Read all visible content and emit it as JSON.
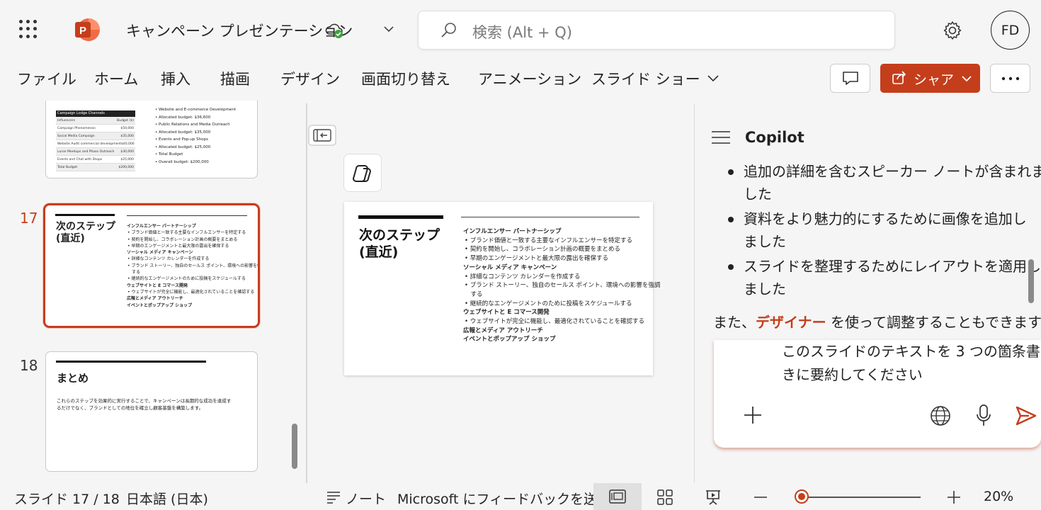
{
  "titlebar": {
    "doc_title": "キャンペーン プレゼンテーション",
    "search_placeholder": "検索 (Alt + Q)",
    "avatar_initials": "FD"
  },
  "ribbon": {
    "tabs": [
      "ファイル",
      "ホーム",
      "挿入",
      "描画",
      "デザイン",
      "画面切り替え",
      "アニメーション",
      "スライド ショー"
    ],
    "share_label": "シャア"
  },
  "thumbnails": {
    "prev": {
      "table_header": "Campaign Lodge Channels",
      "table_rows": [
        "Influencers",
        "Campaign Phenomenon",
        "Social Media Campaign",
        "Website Audit commercial development",
        "Lunar Meetups and Phase Outreach",
        "Events and Chat with Shops",
        "Total Budget"
      ],
      "table_values": [
        "Budget ($)",
        "$50,000",
        "$35,000",
        "$40,000",
        "$30,000",
        "$25,000",
        "$200,000"
      ],
      "bullets": [
        "Website and E-commerce Development",
        "Allocated budget: $36,600",
        "Public Relations and Media Outreach",
        "Allocated budget: $35,000",
        "Events and Pop-up Shops",
        "Allocated budget: $25,000",
        "Total Budget",
        "Overall budget: $200,000"
      ]
    },
    "s17": {
      "number": "17"
    },
    "s18": {
      "number": "18",
      "title": "まとめ",
      "body_1": "これらのステップを効果的に実行することで、キャンペーンは長期的な成功を達成す",
      "body_2": "るだけでなく、ブランドとしての地位を確立し顧客基盤を構築します。"
    }
  },
  "slide": {
    "title_1": "次のステップ",
    "title_2": "(直近)",
    "lines": [
      {
        "text": "インフルエンサー パートナーシップ",
        "kind": "head"
      },
      {
        "text": "ブランド価値と一致する主要なインフルエンサーを特定する",
        "kind": "bullet"
      },
      {
        "text": "契約を開始し、コラボレーション計画の概要をまとめる",
        "kind": "bullet"
      },
      {
        "text": "早期のエンゲージメントと最大限の露出を確保する",
        "kind": "bullet"
      },
      {
        "text": "ソーシャル メディア キャンペーン",
        "kind": "head"
      },
      {
        "text": "詳細なコンテンツ カレンダーを作成する",
        "kind": "bullet"
      },
      {
        "text": "ブランド ストーリー、独自のセールス ポイント、環境への影響を強調",
        "kind": "bullet"
      },
      {
        "text": "する",
        "kind": "cont"
      },
      {
        "text": "継続的なエンゲージメントのために投稿をスケジュールする",
        "kind": "bullet"
      },
      {
        "text": "ウェブサイトと E コマース開発",
        "kind": "head"
      },
      {
        "text": "ウェブサイトが完全に機能し、最適化されていることを確認する",
        "kind": "bullet"
      },
      {
        "text": "広報とメディア アウトリーチ",
        "kind": "head"
      },
      {
        "text": "イベントとポップアップ ショップ",
        "kind": "head"
      }
    ]
  },
  "copilot": {
    "title": "Copilot",
    "bullets": [
      [
        "追加の詳細を含むスピーカー ノートが含まれま",
        "した"
      ],
      [
        "資料をより魅力的にするために画像を追加し",
        "ました"
      ],
      [
        "スライドを整理するためにレイアウトを適用し",
        "ました"
      ]
    ],
    "closing_pre": "また、",
    "closing_link": "デザイナー",
    "closing_post": " を使って調整することもできます",
    "prompt_line1": "このスライドのテキストを 3 つの箇条書",
    "prompt_line2": "きに要約してください"
  },
  "statusbar": {
    "slide_indicator": "スライド 17 / 18",
    "language": "日本語 (日本)",
    "notes_label": "ノート",
    "feedback_label": "Microsoft にフィードバックを送信",
    "zoom_level": "20%"
  },
  "colors": {
    "accent": "#c43e1c",
    "background": "#f5f5f5"
  }
}
